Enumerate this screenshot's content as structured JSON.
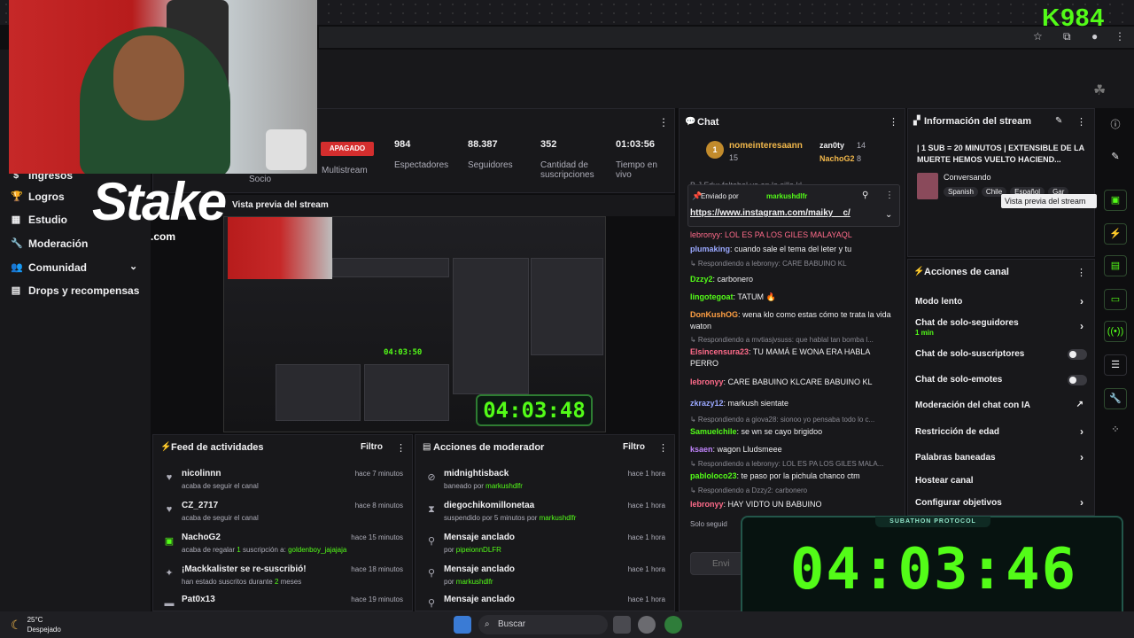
{
  "logo_text": "K984",
  "sidebar": {
    "items": [
      {
        "label": "Ingresos",
        "icon": "money-icon"
      },
      {
        "label": "Logros",
        "icon": "trophy-icon"
      },
      {
        "label": "Estudio",
        "icon": "studio-icon"
      },
      {
        "label": "Moderación",
        "icon": "wrench-icon"
      },
      {
        "label": "Comunidad",
        "icon": "community-icon"
      },
      {
        "label": "Drops y recompensas",
        "icon": "drops-icon"
      }
    ]
  },
  "sponsor": {
    "brand": "Stake",
    "suffix": ".com"
  },
  "stats": {
    "status_badge": "APAGADO",
    "socio_label": "Socio",
    "multistream_label": "Multistream",
    "viewers_value": "984",
    "viewers_label": "Espectadores",
    "followers_value": "88.387",
    "followers_label": "Seguidores",
    "subs_value": "352",
    "subs_label": "Cantidad de suscripciones",
    "uptime_value": "01:03:56",
    "uptime_label": "Tiempo en vivo"
  },
  "preview": {
    "title": "Vista previa del stream",
    "title_visible": "Vista previa del stream",
    "timer": "04:03:48",
    "small_timer": "04:03:50"
  },
  "activity_feed": {
    "title": "Feed de actividades",
    "filter": "Filtro",
    "rows": [
      {
        "icon": "heart-icon",
        "title": "nicolinnn",
        "sub": "acaba de seguir el canal",
        "time": "hace 7 minutos"
      },
      {
        "icon": "heart-icon",
        "title": "CZ_2717",
        "sub": "acaba de seguir el canal",
        "time": "hace 8 minutos"
      },
      {
        "icon": "gift-icon",
        "title": "NachoG2",
        "sub_prefix": "acaba de regalar ",
        "sub_highlight": "1",
        "sub_mid": " suscripción a: ",
        "sub_user": "goldenboy_jajajaja",
        "time": "hace 15 minutos"
      },
      {
        "icon": "sparkle-icon",
        "title": "¡Mackkalister se re-suscribió!",
        "sub_prefix": "han estado suscritos durante ",
        "sub_highlight": "2",
        "sub_mid": " meses",
        "time": "hace 18 minutos"
      },
      {
        "icon": "car-icon",
        "title": "Pat0x13",
        "sub": "",
        "time": "hace 19 minutos"
      }
    ]
  },
  "mod_actions": {
    "title": "Acciones de moderador",
    "filter": "Filtro",
    "rows": [
      {
        "icon": "ban-icon",
        "title": "midnightisback",
        "sub_prefix": "baneado por ",
        "sub_user": "markushdlfr",
        "time": "hace 1 hora"
      },
      {
        "icon": "hourglass-icon",
        "title": "diegochikomillonetaa",
        "sub_prefix": "suspendido por 5 minutos por ",
        "sub_user": "markushdlfr",
        "time": "hace 1 hora"
      },
      {
        "icon": "pin-icon",
        "title": "Mensaje anclado",
        "sub_prefix": "por ",
        "sub_user": "pipeionnDLFR",
        "time": "hace 1 hora"
      },
      {
        "icon": "pin-icon",
        "title": "Mensaje anclado",
        "sub_prefix": "por ",
        "sub_user": "markushdlfr",
        "time": "hace 1 hora"
      },
      {
        "icon": "pin-icon",
        "title": "Mensaje anclado",
        "sub_prefix": "",
        "sub_user": "",
        "time": "hace 1 hora"
      }
    ]
  },
  "chat": {
    "title": "Chat",
    "top_user": "nomeinteresaann",
    "top_user_count": "15",
    "leader2": "zan0ty",
    "leader2_count": "14",
    "leader3": "NachoG2",
    "leader3_count": "8",
    "partial_top": "B.J.Fdu: faltabal yo en la silla kl",
    "pinned_by_label": "Enviado por",
    "pinned_by_user": "markushdlfr",
    "pinned_link": "https://www.instagram.com/maiky__c/",
    "partial_under_pinned": "lebronyy: LOL ES PA LOS GILES MALAYAQL",
    "messages": [
      {
        "type": "msg",
        "user": "plumaking",
        "color": "#9aa8ff",
        "text": ": cuando sale el tema del leter y tu"
      },
      {
        "type": "reply",
        "text": "↳ Respondiendo a lebronyy: CARE BABUINO KL"
      },
      {
        "type": "msg",
        "user": "Dzzy2",
        "color": "#53fc18",
        "text": ": carbonero"
      },
      {
        "type": "msg",
        "user": "lingotegoat",
        "color": "#53fc18",
        "text": ": TATUM 🔥"
      },
      {
        "type": "msg",
        "user": "DonKushOG",
        "color": "#ff9f43",
        "text": ": wena klo como estas cómo te trata la vida waton"
      },
      {
        "type": "reply",
        "text": "↳ Respondiendo a mvtiasjvsuss: que hablal tan bomba l..."
      },
      {
        "type": "msg",
        "user": "Elsincensura23",
        "color": "#ff6b8a",
        "text": ": TU MAMÁ E WONA ERA HABLA PERRO"
      },
      {
        "type": "msg",
        "user": "lebronyy",
        "color": "#ff6b8a",
        "text": ": CARE BABUINO KLCARE BABUINO KL"
      },
      {
        "type": "msg",
        "user": "zkrazy12",
        "color": "#9aa8ff",
        "text": ": markush sientate"
      },
      {
        "type": "reply",
        "text": "↳ Respondiendo a giova28: sionoo yo pensaba todo lo c..."
      },
      {
        "type": "msg",
        "user": "Samuelchile",
        "color": "#53fc18",
        "text": ": se wn se cayo brigidoo"
      },
      {
        "type": "msg",
        "user": "ksaen",
        "color": "#c084fc",
        "text": ": wagon Lludsmeee"
      },
      {
        "type": "reply",
        "text": "↳ Respondiendo a lebronyy: LOL ES PA LOS GILES MALA..."
      },
      {
        "type": "msg",
        "user": "pabloloco23",
        "color": "#53fc18",
        "text": ": te paso por la pichula chanco ctm"
      },
      {
        "type": "reply",
        "text": "↳ Respondiendo a Dzzy2: carbonero"
      },
      {
        "type": "msg",
        "user": "lebronyy",
        "color": "#ff6b8a",
        "text": ": HAY VIDTO UN BABUINO"
      }
    ],
    "followers_only_partial": "Solo seguid",
    "input_placeholder": "Envi"
  },
  "stream_info": {
    "title": "Información del stream",
    "stream_title": "| 1 SUB = 20 MINUTOS | EXTENSIBLE DE LA MUERTE HEMOS VUELTO HACIEND...",
    "category": "Conversando",
    "tags": [
      "Spanish",
      "Chile",
      "Español",
      "Gar"
    ]
  },
  "channel_actions": {
    "title": "Acciones de canal",
    "items": [
      {
        "label": "Modo lento",
        "control": "chevron"
      },
      {
        "label": "Chat de solo-seguidores",
        "sub": "1 min",
        "control": "chevron"
      },
      {
        "label": "Chat de solo-suscriptores",
        "control": "toggle"
      },
      {
        "label": "Chat de solo-emotes",
        "control": "toggle"
      },
      {
        "label": "Moderación del chat con IA",
        "control": "external"
      },
      {
        "label": "Restricción de edad",
        "control": "chevron"
      },
      {
        "label": "Palabras baneadas",
        "control": "chevron"
      },
      {
        "label": "Hostear canal",
        "control": "none"
      },
      {
        "label": "Configurar objetivos",
        "control": "chevron"
      }
    ]
  },
  "tooltip": "Vista previa del stream",
  "overlay": {
    "label": "SUBATHON PROTOCOL",
    "timer": "04:03:46"
  },
  "taskbar": {
    "temp": "25°C",
    "weather": "Despejado",
    "search_placeholder": "Buscar"
  },
  "colors": {
    "accent": "#53fc18",
    "danger": "#d42e2e",
    "panel": "#18181b",
    "bg": "#0e0e10"
  }
}
